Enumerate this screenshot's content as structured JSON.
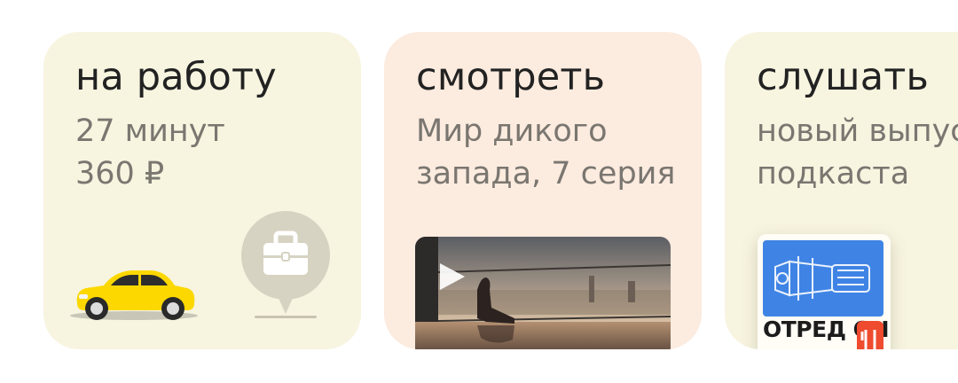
{
  "cards": [
    {
      "title": "на работу",
      "line1": "27 минут",
      "line2": "360 ₽",
      "background": "#f7f4e0"
    },
    {
      "title": "смотреть",
      "line1": "Мир дикого",
      "line2": "запада, 7 серия",
      "background": "#fcebdf"
    },
    {
      "title": "слушать",
      "line1": "новый выпуск",
      "line2": "подкаста",
      "background": "#f7f4e0"
    }
  ],
  "podcast": {
    "brand_text": "ОТРЕД ОЧЕНЬ"
  },
  "colors": {
    "taxi_yellow": "#fcd800",
    "pin_grey": "#d7d3c2",
    "podcast_blue": "#3f84e5",
    "podcast_orange": "#ef4b2e"
  },
  "icons": {
    "car": "taxi-car-icon",
    "briefcase": "briefcase-pin-icon",
    "play": "play-icon"
  }
}
